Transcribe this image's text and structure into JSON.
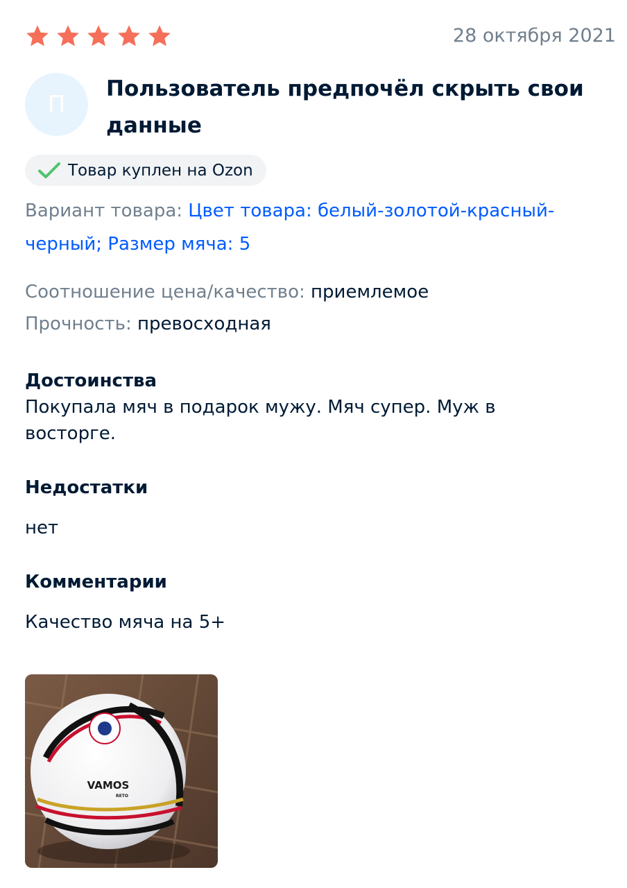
{
  "review": {
    "rating": 5,
    "date": "28 октября 2021",
    "avatar_letter": "П",
    "author": "Пользователь предпочёл скрыть свои данные",
    "badge": {
      "icon": "check-icon",
      "text": "Товар куплен на Ozon"
    },
    "variant": {
      "label": "Вариант товара:",
      "value": "Цвет товара: белый-золотой-красный-черный; Размер мяча: 5"
    },
    "attributes": [
      {
        "label": "Соотношение цена/качество:",
        "value": "приемлемое"
      },
      {
        "label": "Прочность:",
        "value": "превосходная"
      }
    ],
    "sections": [
      {
        "title": "Достоинства",
        "text": "Покупала мяч в подарок мужу. Мяч супер. Муж в восторге."
      },
      {
        "title": "Недостатки",
        "text": "нет"
      },
      {
        "title": "Комментарии",
        "text": "Качество мяча на 5+"
      }
    ],
    "photo": {
      "brand": "VAMOS",
      "model": "RETO"
    }
  },
  "colors": {
    "star": "#f56f5a",
    "link": "#005bff",
    "muted": "#707f8d",
    "text": "#001a34",
    "check": "#4fc46c",
    "badge_bg": "#f2f3f5",
    "avatar_bg": "#e8f4fd"
  }
}
